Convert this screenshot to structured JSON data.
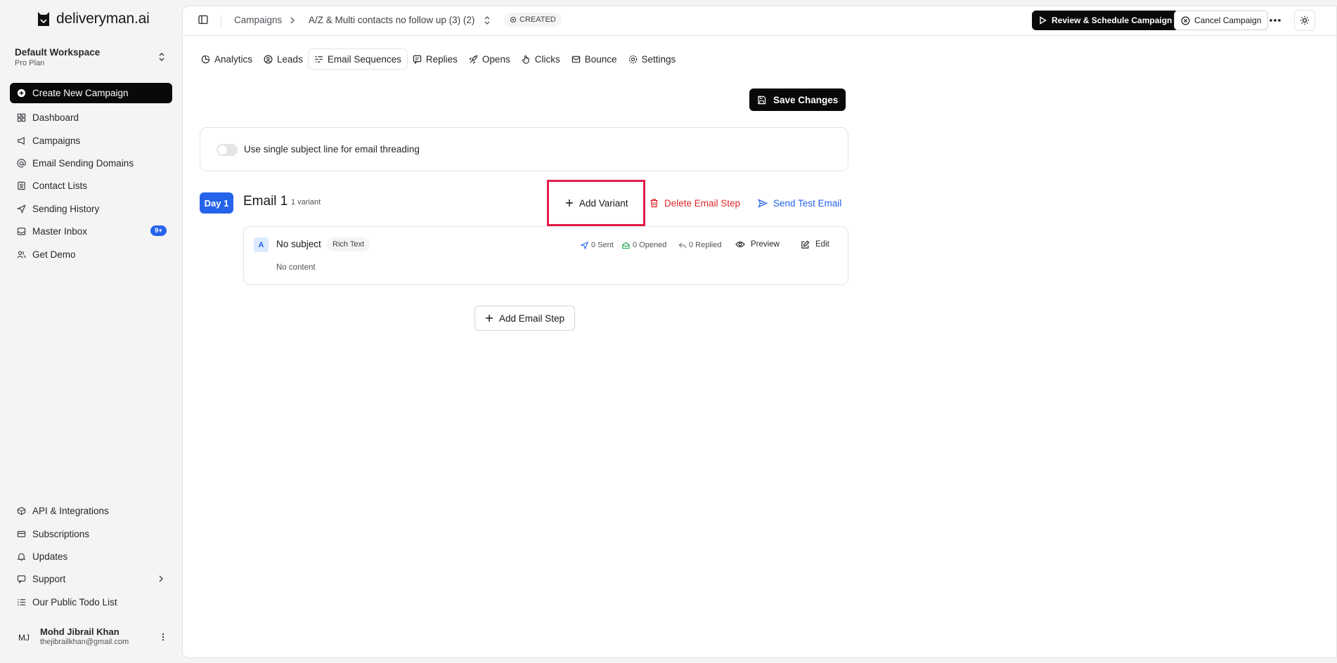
{
  "brand": {
    "name": "deliveryman.ai"
  },
  "workspace": {
    "name": "Default Workspace",
    "plan": "Pro Plan"
  },
  "sidebar": {
    "primary": {
      "label": "Create New Campaign",
      "icon": "plus-circle-icon"
    },
    "items": [
      {
        "label": "Dashboard",
        "icon": "dashboard-icon"
      },
      {
        "label": "Campaigns",
        "icon": "megaphone-icon"
      },
      {
        "label": "Email Sending Domains",
        "icon": "at-sign-icon"
      },
      {
        "label": "Contact Lists",
        "icon": "contacts-icon"
      },
      {
        "label": "Sending History",
        "icon": "send-icon"
      },
      {
        "label": "Master Inbox",
        "icon": "inbox-icon",
        "badge": "9+"
      },
      {
        "label": "Get Demo",
        "icon": "users-icon"
      }
    ],
    "bottom_items": [
      {
        "label": "API & Integrations",
        "icon": "api-icon"
      },
      {
        "label": "Subscriptions",
        "icon": "card-icon"
      },
      {
        "label": "Updates",
        "icon": "bell-icon"
      },
      {
        "label": "Support",
        "icon": "message-icon"
      },
      {
        "label": "Our Public Todo List",
        "icon": "list-icon"
      }
    ]
  },
  "user": {
    "initials": "MJ",
    "name": "Mohd Jibrail Khan",
    "email": "thejibrailkhan@gmail.com"
  },
  "topbar": {
    "breadcrumb_root": "Campaigns",
    "breadcrumb_current": "A/Z & Multi contacts no follow up (3) (2)",
    "status": "CREATED",
    "review_label": "Review & Schedule Campaign",
    "cancel_label": "Cancel Campaign"
  },
  "tabs": [
    {
      "label": "Analytics",
      "icon": "pie-chart-icon"
    },
    {
      "label": "Leads",
      "icon": "user-circle-icon"
    },
    {
      "label": "Email Sequences",
      "icon": "sequence-icon",
      "active": true
    },
    {
      "label": "Replies",
      "icon": "reply-icon"
    },
    {
      "label": "Opens",
      "icon": "rocket-icon"
    },
    {
      "label": "Clicks",
      "icon": "pointer-icon"
    },
    {
      "label": "Bounce",
      "icon": "mail-icon"
    },
    {
      "label": "Settings",
      "icon": "gear-icon"
    }
  ],
  "editor": {
    "save_label": "Save Changes",
    "threading_label": "Use single subject line for email threading",
    "threading_enabled": false,
    "steps": [
      {
        "day": "Day 1",
        "title": "Email 1",
        "variant_count": "1 variant",
        "add_variant_label": "Add Variant",
        "delete_label": "Delete Email Step",
        "send_test_label": "Send Test Email",
        "variants": [
          {
            "letter": "A",
            "subject": "No subject",
            "format": "Rich Text",
            "sent": "0 Sent",
            "opened": "0 Opened",
            "replied": "0 Replied",
            "preview_label": "Preview",
            "edit_label": "Edit",
            "body": "No content"
          }
        ]
      }
    ],
    "add_step_label": "Add Email Step"
  },
  "colors": {
    "accent": "#2563eb",
    "danger": "#dc2626",
    "dark": "#09090b",
    "highlight": "#e11d48"
  }
}
